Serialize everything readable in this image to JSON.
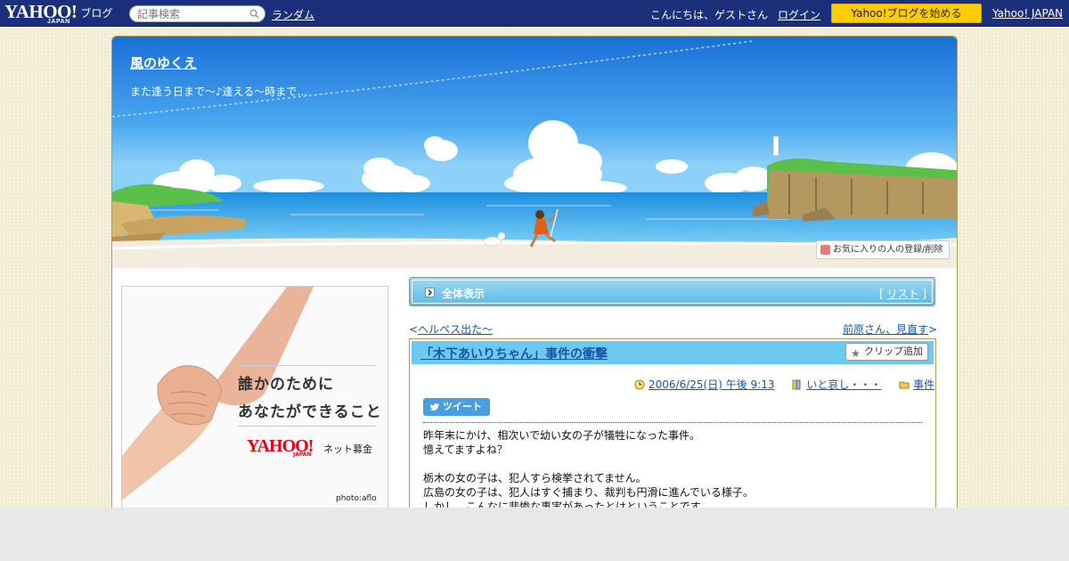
{
  "topbar": {
    "logo_text": "YAHOO!",
    "logo_sub": "JAPAN",
    "blog_label": "ブログ",
    "search_placeholder": "記事検索",
    "random_label": "ランダム",
    "greeting": "こんにちは、ゲストさん",
    "login_label": "ログイン",
    "start_button": "Yahoo!ブログを始める",
    "yahoo_japan_link": "Yahoo! JAPAN"
  },
  "header": {
    "blog_title": "風のゆくえ",
    "blog_description": "また逢う日まで～♪逢える～時まで…",
    "favorite_button": "お気に入りの人の登録/削除"
  },
  "ad": {
    "line1": "誰かのために",
    "line2": "あなたができること",
    "logo": "YAHOO!",
    "logo_sub": "JAPAN",
    "service": "ネット募金",
    "credit": "photo:aflo"
  },
  "nav": {
    "all_view_label": "全体表示",
    "list_label": "リスト",
    "prev_article": "ヘルペス出た～",
    "next_article": "前原さん、見直す"
  },
  "article": {
    "title": "「木下あいりちゃん」事件の衝撃",
    "clip_button": "クリップ追加",
    "date": "2006/6/25(日) 午後 9:13",
    "tag": "いと哀し・・・",
    "category": "事件",
    "tweet_button": "ツイート",
    "body_lines": [
      "昨年末にかけ、相次いで幼い女の子が犠牲になった事件。",
      "憶えてますよね？",
      "",
      "栃木の女の子は、犯人すら検挙されてません。",
      "広島の女の子は、犯人はすぐ捕まり、裁判も円滑に進んでいる様子。",
      "しかし、こんなに悲惨な事実があったとはということです。"
    ]
  },
  "colors": {
    "topbar_bg": "#1b2f7a",
    "start_button_bg": "#ffcc00",
    "link": "#1a55a8",
    "article_header_bg": "#6ccaf0"
  }
}
